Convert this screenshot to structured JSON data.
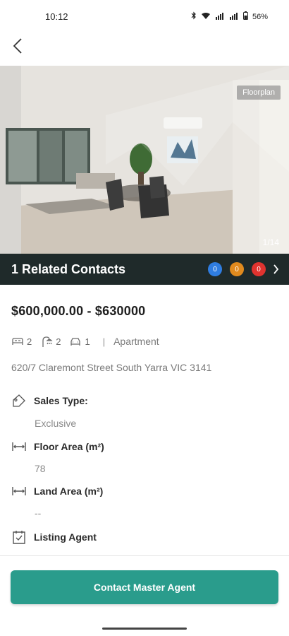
{
  "status_bar": {
    "time": "10:12",
    "battery": "56%"
  },
  "hero": {
    "floorplan_label": "Floorplan",
    "photo_counter": "1/14"
  },
  "contacts": {
    "title": "1 Related Contacts",
    "badges": [
      {
        "value": "0",
        "color": "#2f7de1"
      },
      {
        "value": "0",
        "color": "#e08a1e"
      },
      {
        "value": "0",
        "color": "#e0332f"
      }
    ]
  },
  "listing": {
    "price": "$600,000.00  - $630000",
    "bedrooms": "2",
    "bathrooms": "2",
    "parking": "1",
    "property_type": "Apartment",
    "address": "620/7 Claremont Street South Yarra VIC 3141"
  },
  "details": {
    "sales_type_label": "Sales Type:",
    "sales_type_value": "Exclusive",
    "floor_area_label": "Floor Area (m²)",
    "floor_area_value": "78",
    "land_area_label": "Land Area (m²)",
    "land_area_value": "--",
    "listing_agent_label": "Listing Agent"
  },
  "cta_label": "Contact Master Agent",
  "colors": {
    "accent": "#2a9c8c",
    "contacts_bar": "#1f2a2a"
  }
}
